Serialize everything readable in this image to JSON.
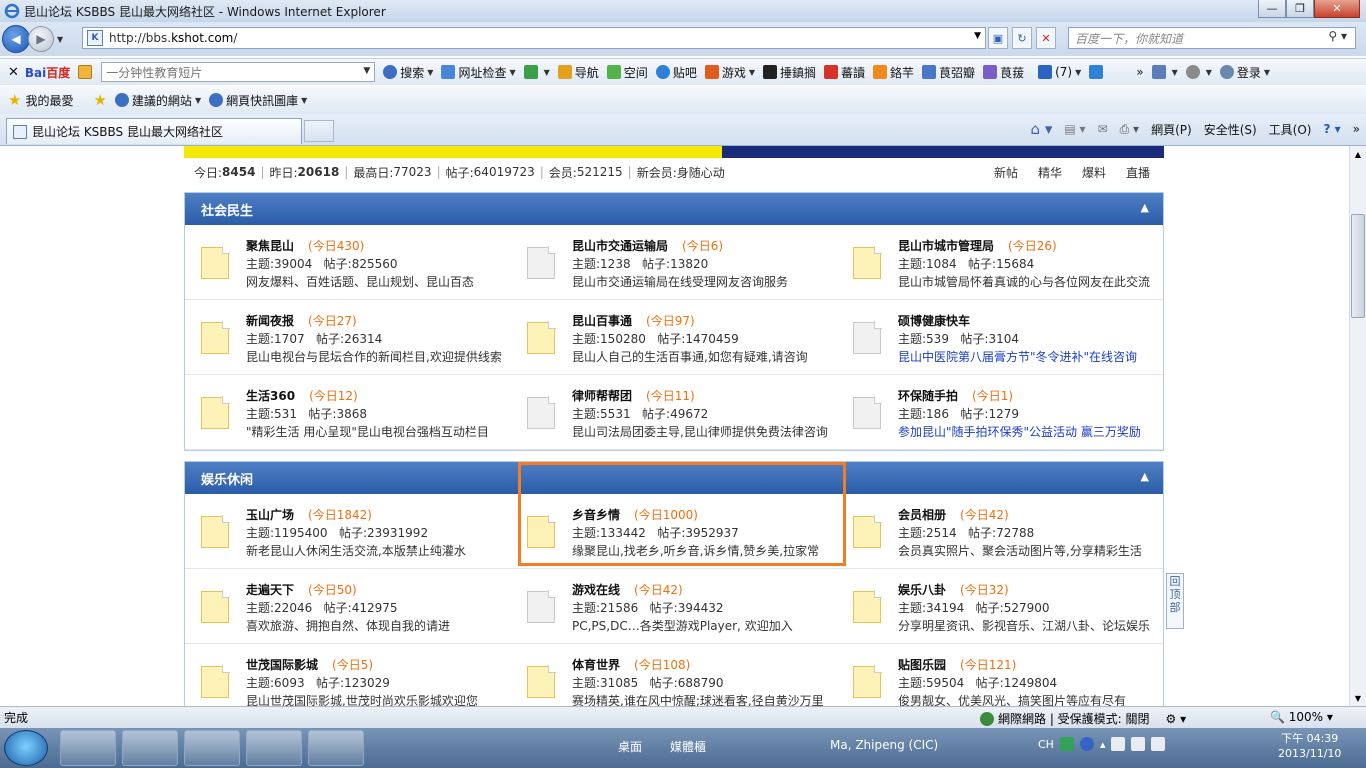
{
  "window": {
    "title": "昆山论坛 KSBBS 昆山最大网络社区 - Windows Internet Explorer",
    "buttons": {
      "min": "—",
      "max": "❐",
      "close": "✕"
    }
  },
  "nav": {
    "url_prefix": "http://bbs.",
    "url_host": "kshot.com",
    "url_suffix": "/",
    "search_placeholder": "百度一下，你就知道"
  },
  "baidu_bar": {
    "brand_a": "Bai",
    "brand_b": "百度",
    "search_value": "一分钟性教育短片",
    "items": [
      "搜索",
      "网址检查",
      "导航",
      "空间",
      "贴吧",
      "游戏",
      "捶鎮搁",
      "蕃讀",
      "鉻芉",
      "茛弨瓣",
      "茛菝"
    ],
    "mail_count": "(7)",
    "login": "登录"
  },
  "fav_bar": {
    "favorites": "我的最愛",
    "suggested": "建議的網站",
    "gallery": "網頁快訊圖庫"
  },
  "tabbar": {
    "tab_title": "昆山论坛 KSBBS 昆山最大网络社区",
    "cmds": [
      "網頁(P)",
      "安全性(S)",
      "工具(O)"
    ]
  },
  "stats": {
    "today_label": "今日:",
    "today": "8454",
    "yesterday_label": "昨日:",
    "yesterday": "20618",
    "max_label": "最高日:",
    "max": "77023",
    "posts_label": "帖子:",
    "posts": "64019723",
    "members_label": "会员:",
    "members": "521215",
    "newmember_label": "新会员:",
    "newmember": "身随心动",
    "links": [
      "新帖",
      "精华",
      "爆料",
      "直播"
    ]
  },
  "sections": [
    {
      "title": "社会民生",
      "rows": [
        [
          {
            "name": "聚焦昆山",
            "today": "(今日430)",
            "topics": "主题:39004",
            "posts": "帖子:825560",
            "desc": "网友爆料、百姓话题、昆山规划、昆山百态",
            "icon": "new"
          },
          {
            "name": "昆山市交通运输局",
            "today": "(今日6)",
            "topics": "主题:1238",
            "posts": "帖子:13820",
            "desc": "昆山市交通运输局在线受理网友咨询服务",
            "icon": "old"
          },
          {
            "name": "昆山市城市管理局",
            "today": "(今日26)",
            "topics": "主题:1084",
            "posts": "帖子:15684",
            "desc": "昆山市城管局怀着真诚的心与各位网友在此交流",
            "icon": "new"
          }
        ],
        [
          {
            "name": "新闻夜报",
            "today": "(今日27)",
            "topics": "主题:1707",
            "posts": "帖子:26314",
            "desc": "昆山电视台与昆坛合作的新闻栏目,欢迎提供线索",
            "icon": "new"
          },
          {
            "name": "昆山百事通",
            "today": "(今日97)",
            "topics": "主题:150280",
            "posts": "帖子:1470459",
            "desc": "昆山人自己的生活百事通,如您有疑难,请咨询",
            "icon": "new"
          },
          {
            "name": "硕博健康快车",
            "today": "",
            "topics": "主题:539",
            "posts": "帖子:3104",
            "desc": "昆山中医院第八届膏方节\"冬令进补\"在线咨询",
            "icon": "old",
            "link": true
          }
        ],
        [
          {
            "name": "生活360",
            "today": "(今日12)",
            "topics": "主题:531",
            "posts": "帖子:3868",
            "desc": "\"精彩生活 用心呈现\"昆山电视台强档互动栏目",
            "icon": "new"
          },
          {
            "name": "律师帮帮团",
            "today": "(今日11)",
            "topics": "主题:5531",
            "posts": "帖子:49672",
            "desc": "昆山司法局团委主导,昆山律师提供免费法律咨询",
            "icon": "old"
          },
          {
            "name": "环保随手拍",
            "today": "(今日1)",
            "topics": "主题:186",
            "posts": "帖子:1279",
            "desc": "参加昆山\"随手拍环保秀\"公益活动 赢三万奖励",
            "icon": "old",
            "link": true
          }
        ]
      ]
    },
    {
      "title": "娱乐休闲",
      "rows": [
        [
          {
            "name": "玉山广场",
            "today": "(今日1842)",
            "topics": "主题:1195400",
            "posts": "帖子:23931992",
            "desc": "新老昆山人休闲生活交流,本版禁止纯灌水",
            "icon": "new"
          },
          {
            "name": "乡音乡情",
            "today": "(今日1000)",
            "topics": "主题:133442",
            "posts": "帖子:3952937",
            "desc": "缘聚昆山,找老乡,听乡音,诉乡情,赞乡美,拉家常",
            "icon": "new"
          },
          {
            "name": "会员相册",
            "today": "(今日42)",
            "topics": "主题:2514",
            "posts": "帖子:72788",
            "desc": "会员真实照片、聚会活动图片等,分享精彩生活",
            "icon": "new"
          }
        ],
        [
          {
            "name": "走遍天下",
            "today": "(今日50)",
            "topics": "主题:22046",
            "posts": "帖子:412975",
            "desc": "喜欢旅游、拥抱自然、体现自我的请进",
            "icon": "new"
          },
          {
            "name": "游戏在线",
            "today": "(今日42)",
            "topics": "主题:21586",
            "posts": "帖子:394432",
            "desc": "PC,PS,DC…各类型游戏Player, 欢迎加入",
            "icon": "old"
          },
          {
            "name": "娱乐八卦",
            "today": "(今日32)",
            "topics": "主题:34194",
            "posts": "帖子:527900",
            "desc": "分享明星资讯、影视音乐、江湖八卦、论坛娱乐",
            "icon": "new"
          }
        ],
        [
          {
            "name": "世茂国际影城",
            "today": "(今日5)",
            "topics": "主题:6093",
            "posts": "帖子:123029",
            "desc": "昆山世茂国际影城,世茂时尚欢乐影城欢迎您",
            "icon": "new"
          },
          {
            "name": "体育世界",
            "today": "(今日108)",
            "topics": "主题:31085",
            "posts": "帖子:688790",
            "desc": "赛场精英,谁在风中惊醒;球迷看客,径自黄沙万里",
            "icon": "new"
          },
          {
            "name": "贴图乐园",
            "today": "(今日121)",
            "topics": "主题:59504",
            "posts": "帖子:1249804",
            "desc": "俊男靓女、优美风光、搞笑图片等应有尽有",
            "icon": "new"
          }
        ]
      ]
    }
  ],
  "collapse_glyph": "▲",
  "back_to_top": "回顶部",
  "status": {
    "left": "完成",
    "zone": "網際網路 | 受保護模式: 關閉",
    "zoom": "100%"
  },
  "taskbar": {
    "desktop": "桌面",
    "media": "媒體櫃",
    "user": "Ma, Zhipeng (CIC)",
    "lang": "CH",
    "time": "下午 04:39",
    "date": "2013/11/10"
  }
}
